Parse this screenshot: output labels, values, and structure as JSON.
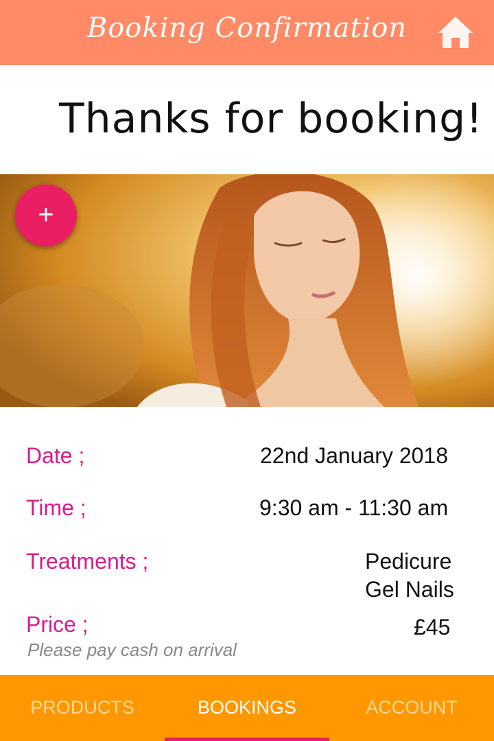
{
  "header": {
    "title": "Booking Confirmation",
    "home_icon": "home-icon"
  },
  "main": {
    "heading": "Thanks for booking!",
    "add_button": "+",
    "add_icon": "plus-icon"
  },
  "details": {
    "date_label": "Date ;",
    "date_value": "22nd January 2018",
    "time_label": "Time ;",
    "time_value": "9:30 am - 11:30 am",
    "treatments_label": "Treatments ;",
    "treatments": [
      "Pedicure",
      "Gel Nails"
    ],
    "price_label": "Price ;",
    "price_value": "£45",
    "payment_note": "Please pay cash on arrival"
  },
  "nav": {
    "tabs": [
      {
        "label": "PRODUCTS",
        "active": false
      },
      {
        "label": "BOOKINGS",
        "active": true
      },
      {
        "label": "ACCOUNT",
        "active": false
      }
    ]
  },
  "colors": {
    "header": "#ff8a65",
    "nav": "#ff9800",
    "accent": "#e91e63",
    "label": "#d81b8c"
  }
}
